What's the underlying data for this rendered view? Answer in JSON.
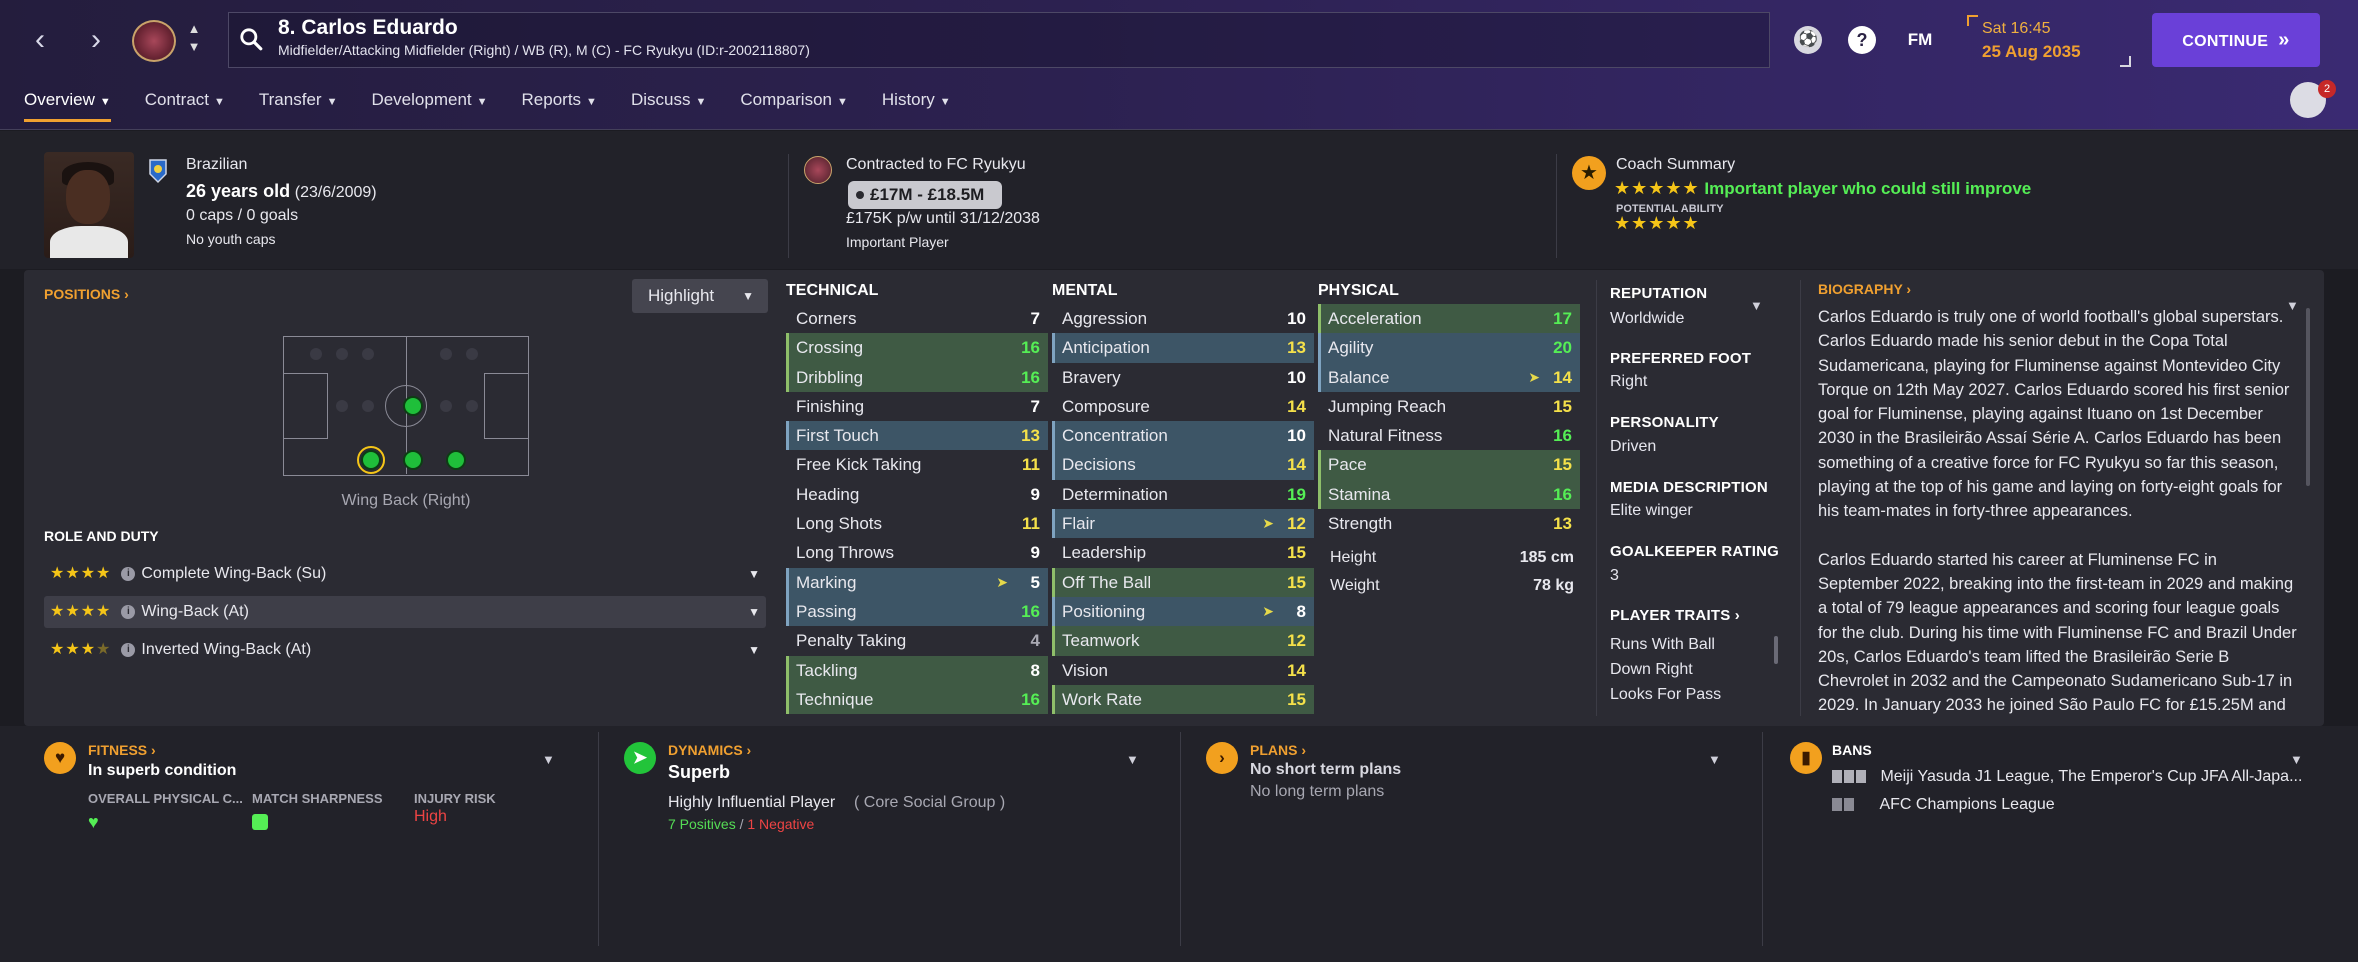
{
  "header": {
    "player_title": "8. Carlos Eduardo",
    "player_subtitle": "Midfielder/Attacking Midfielder (Right) / WB (R), M (C) - FC Ryukyu (ID:r-2002118807)",
    "fm_label": "FM",
    "help_label": "?",
    "date_time": "Sat 16:45",
    "date": "25 Aug 2035",
    "continue_label": "CONTINUE",
    "notification_count": "2",
    "colors": {
      "accent": "#6a40d8",
      "date": "#f0a030"
    }
  },
  "tabs": [
    {
      "label": "Overview",
      "active": true
    },
    {
      "label": "Contract"
    },
    {
      "label": "Transfer"
    },
    {
      "label": "Development"
    },
    {
      "label": "Reports"
    },
    {
      "label": "Discuss"
    },
    {
      "label": "Comparison"
    },
    {
      "label": "History"
    }
  ],
  "info": {
    "nationality": "Brazilian",
    "age": "26 years old",
    "dob": "(23/6/2009)",
    "caps": "0 caps / 0 goals",
    "youth_caps": "No youth caps",
    "contract_club": "Contracted to FC Ryukyu",
    "value_range": "£17M - £18.5M",
    "wage": "£175K p/w until 31/12/2038",
    "squad_status": "Important Player",
    "coach_summary_label": "Coach Summary",
    "coach_summary_text": "Important player who could still improve",
    "current_ability_stars": 5,
    "potential_ability_label": "POTENTIAL ABILITY",
    "potential_ability_stars": 5
  },
  "positions": {
    "label": "POSITIONS",
    "highlight_label": "Highlight",
    "selected_position": "Wing Back (Right)",
    "role_duty_label": "ROLE AND DUTY",
    "roles": [
      {
        "name": "Complete Wing-Back (Su)",
        "stars": 4.0
      },
      {
        "name": "Wing-Back (At)",
        "stars": 4.0,
        "selected": true
      },
      {
        "name": "Inverted Wing-Back (At)",
        "stars": 3.5
      }
    ]
  },
  "attributes": {
    "technical_label": "TECHNICAL",
    "mental_label": "MENTAL",
    "physical_label": "PHYSICAL",
    "technical": [
      {
        "name": "Corners",
        "value": "7"
      },
      {
        "name": "Crossing",
        "value": "16",
        "hl": "h2"
      },
      {
        "name": "Dribbling",
        "value": "16",
        "hl": "h2"
      },
      {
        "name": "Finishing",
        "value": "7"
      },
      {
        "name": "First Touch",
        "value": "13",
        "hl": "h1"
      },
      {
        "name": "Free Kick Taking",
        "value": "11"
      },
      {
        "name": "Heading",
        "value": "9"
      },
      {
        "name": "Long Shots",
        "value": "11"
      },
      {
        "name": "Long Throws",
        "value": "9"
      },
      {
        "name": "Marking",
        "value": "5",
        "hl": "h1",
        "arrow": true
      },
      {
        "name": "Passing",
        "value": "16",
        "hl": "h1"
      },
      {
        "name": "Penalty Taking",
        "value": "4"
      },
      {
        "name": "Tackling",
        "value": "8",
        "hl": "h2"
      },
      {
        "name": "Technique",
        "value": "16",
        "hl": "h2"
      }
    ],
    "mental": [
      {
        "name": "Aggression",
        "value": "10"
      },
      {
        "name": "Anticipation",
        "value": "13",
        "hl": "h1"
      },
      {
        "name": "Bravery",
        "value": "10"
      },
      {
        "name": "Composure",
        "value": "14"
      },
      {
        "name": "Concentration",
        "value": "10",
        "hl": "h1"
      },
      {
        "name": "Decisions",
        "value": "14",
        "hl": "h1"
      },
      {
        "name": "Determination",
        "value": "19"
      },
      {
        "name": "Flair",
        "value": "12",
        "hl": "h1",
        "arrow": true
      },
      {
        "name": "Leadership",
        "value": "15"
      },
      {
        "name": "Off The Ball",
        "value": "15",
        "hl": "h2"
      },
      {
        "name": "Positioning",
        "value": "8",
        "hl": "h1",
        "arrow": true
      },
      {
        "name": "Teamwork",
        "value": "12",
        "hl": "h2"
      },
      {
        "name": "Vision",
        "value": "14"
      },
      {
        "name": "Work Rate",
        "value": "15",
        "hl": "h2"
      }
    ],
    "physical": [
      {
        "name": "Acceleration",
        "value": "17",
        "hl": "h2"
      },
      {
        "name": "Agility",
        "value": "20",
        "hl": "h1"
      },
      {
        "name": "Balance",
        "value": "14",
        "hl": "h1",
        "arrow": true
      },
      {
        "name": "Jumping Reach",
        "value": "15"
      },
      {
        "name": "Natural Fitness",
        "value": "16"
      },
      {
        "name": "Pace",
        "value": "15",
        "hl": "h2"
      },
      {
        "name": "Stamina",
        "value": "16",
        "hl": "h2"
      },
      {
        "name": "Strength",
        "value": "13"
      }
    ],
    "height_label": "Height",
    "height": "185 cm",
    "weight_label": "Weight",
    "weight": "78 kg"
  },
  "side": {
    "reputation_label": "REPUTATION",
    "reputation": "Worldwide",
    "foot_label": "PREFERRED FOOT",
    "foot": "Right",
    "personality_label": "PERSONALITY",
    "personality": "Driven",
    "media_label": "MEDIA DESCRIPTION",
    "media": "Elite winger",
    "gk_label": "GOALKEEPER RATING",
    "gk": "3",
    "traits_label": "PLAYER TRAITS",
    "traits": [
      "Runs With Ball",
      "Down Right",
      "Looks For Pass"
    ]
  },
  "biography": {
    "label": "BIOGRAPHY",
    "p1": "Carlos Eduardo is truly one of world football's global superstars. Carlos Eduardo made his senior debut in the Copa Total Sudamericana, playing for Fluminense against Montevideo City Torque on 12th May 2027. Carlos Eduardo scored his first senior goal for Fluminense, playing against Ituano on 1st December 2030 in the Brasileirão Assaí Série A. Carlos Eduardo has been something of a creative force for FC Ryukyu so far this season, playing at the top of his game and laying on forty-eight goals for his team-mates in forty-three appearances.",
    "p2": "Carlos Eduardo started his career at Fluminense FC in September 2022, breaking into the first-team in 2029 and making a total of 79 league appearances and scoring four league goals for the club. During his time with Fluminense FC and Brazil Under 20s, Carlos Eduardo's team lifted the Brasileirão Serie B Chevrolet in 2032 and the Campeonato Sudamericano Sub-17 in 2029. In January 2033 he joined São Paulo FC for £15.25M and"
  },
  "bottom": {
    "fitness_label": "FITNESS",
    "fitness_value": "In superb condition",
    "overall_label": "OVERALL PHYSICAL C...",
    "sharpness_label": "MATCH SHARPNESS",
    "injury_label": "INJURY RISK",
    "injury_value": "High",
    "dynamics_label": "DYNAMICS",
    "dynamics_value": "Superb",
    "influence": "Highly Influential Player",
    "group": "( Core Social Group )",
    "positives": "7 Positives",
    "negatives": "1 Negative",
    "plans_label": "PLANS",
    "short_plans": "No short term plans",
    "long_plans": "No long term plans",
    "bans_label": "BANS",
    "bans": [
      "Meiji Yasuda J1 League, The Emperor's Cup JFA All-Japa...",
      "AFC Champions League"
    ]
  }
}
